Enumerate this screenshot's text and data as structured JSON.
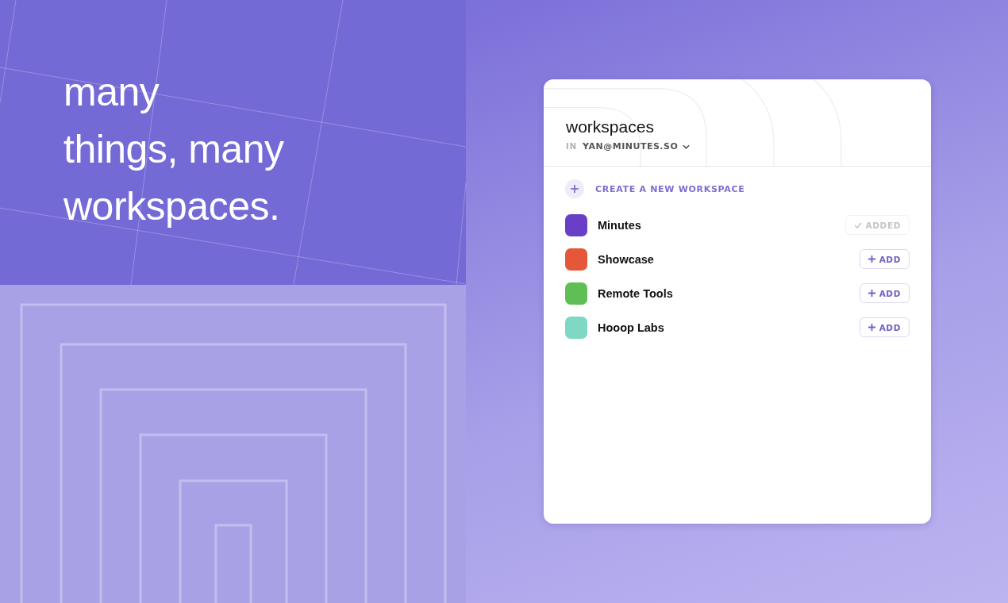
{
  "headline_lines": [
    "many",
    "things, many",
    "workspaces."
  ],
  "card": {
    "title": "workspaces",
    "account_prefix": "IN",
    "account": "YAN@MINUTES.SO",
    "create_label": "CREATE A NEW WORKSPACE",
    "workspaces": [
      {
        "name": "Minutes",
        "color": "#6a3fc8",
        "added": true,
        "action": "ADDED"
      },
      {
        "name": "Showcase",
        "color": "#e6573a",
        "added": false,
        "action": "ADD"
      },
      {
        "name": "Remote Tools",
        "color": "#5fbf55",
        "added": false,
        "action": "ADD"
      },
      {
        "name": "Hooop Labs",
        "color": "#7fd8c4",
        "added": false,
        "action": "ADD"
      }
    ]
  }
}
